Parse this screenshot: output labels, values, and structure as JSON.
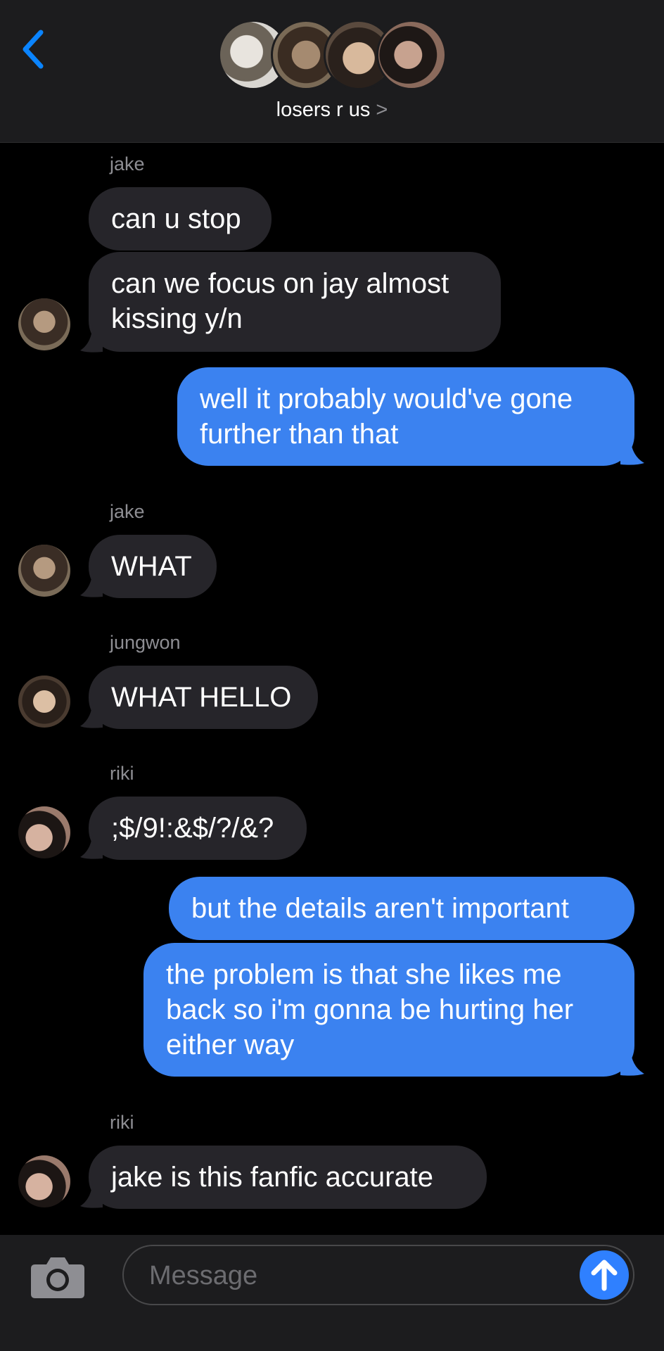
{
  "header": {
    "title": "losers r us",
    "chevron": ">",
    "back_icon": "chevron-left-icon",
    "accent": "#0a84ff"
  },
  "messages": [
    {
      "sender": "jake",
      "text": "can u stop",
      "dir": "in"
    },
    {
      "sender": "jake",
      "text": "can we focus on jay almost kissing y/n",
      "dir": "in"
    },
    {
      "sender": "me",
      "text": "well it probably would've gone further than that",
      "dir": "out"
    },
    {
      "sender": "jake",
      "text": "WHAT",
      "dir": "in"
    },
    {
      "sender": "jungwon",
      "text": "WHAT HELLO",
      "dir": "in"
    },
    {
      "sender": "riki",
      "text": ";$/9!:&$/?/&?",
      "dir": "in"
    },
    {
      "sender": "me",
      "text": "but the details aren't important",
      "dir": "out"
    },
    {
      "sender": "me",
      "text": "the problem is that she likes me back so i'm gonna be hurting her either way",
      "dir": "out"
    },
    {
      "sender": "riki",
      "text": "jake is this fanfic accurate",
      "dir": "in"
    }
  ],
  "sender_labels": [
    "jake",
    "jake",
    "jungwon",
    "riki",
    "riki"
  ],
  "composer": {
    "placeholder": "Message",
    "camera_icon": "camera-icon",
    "send_icon": "arrow-up-icon"
  },
  "colors": {
    "outgoing_bubble": "#3b82f0",
    "incoming_bubble": "#26252a",
    "background": "#000000"
  }
}
